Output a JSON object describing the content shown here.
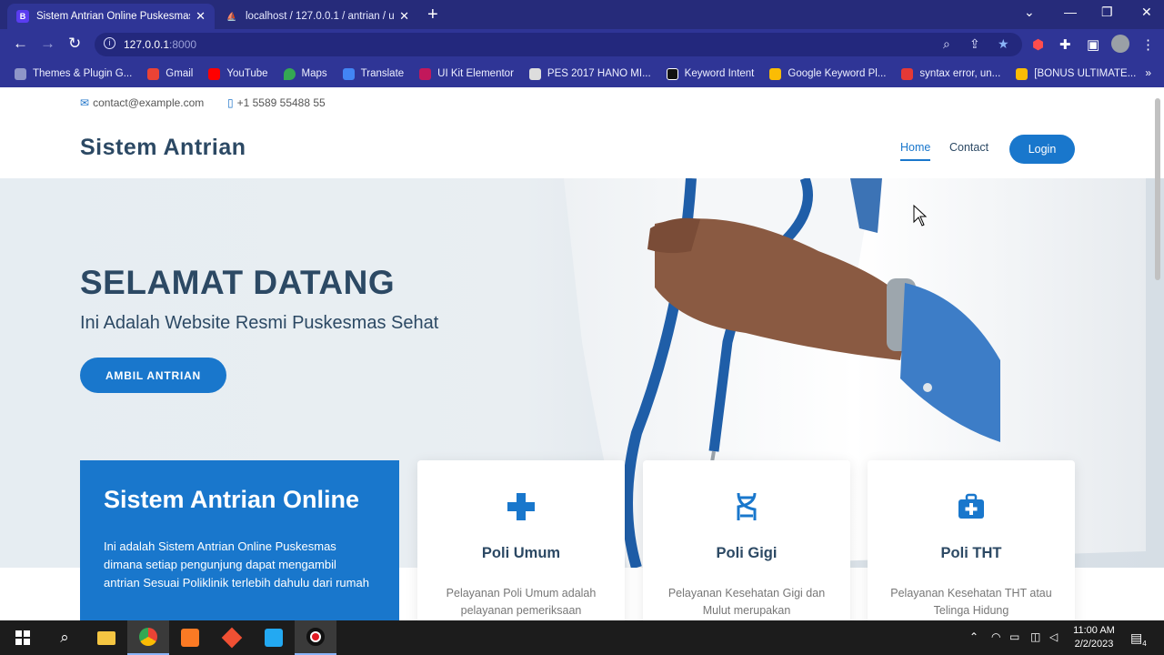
{
  "browser": {
    "tabs": [
      {
        "title": "Sistem Antrian Online Puskesmas",
        "favicon": "B",
        "active": true
      },
      {
        "title": "localhost / 127.0.0.1 / antrian / u",
        "favicon": "phpmyadmin-icon",
        "active": false
      }
    ],
    "url": {
      "host": "127.0.0.1",
      "port": ":8000"
    },
    "bookmarks": [
      {
        "label": "Themes & Plugin G...",
        "color": "#8f96c8"
      },
      {
        "label": "Gmail",
        "color": "#ea4335"
      },
      {
        "label": "YouTube",
        "color": "#ff0000"
      },
      {
        "label": "Maps",
        "color": "#34a853"
      },
      {
        "label": "Translate",
        "color": "#4285f4"
      },
      {
        "label": "UI Kit Elementor",
        "color": "#c2185b"
      },
      {
        "label": "PES 2017 HANO MI...",
        "color": "#dddddd"
      },
      {
        "label": "Keyword Intent",
        "color": "#111111"
      },
      {
        "label": "Google Keyword Pl...",
        "color": "#fbbc04"
      },
      {
        "label": "syntax error, un...",
        "color": "#e53935"
      },
      {
        "label": "[BONUS ULTIMATE...",
        "color": "#fbbc04"
      }
    ]
  },
  "site": {
    "topbar": {
      "email": "contact@example.com",
      "phone": "+1 5589 55488 55"
    },
    "logo": "Sistem Antrian",
    "nav": {
      "home": "Home",
      "contact": "Contact",
      "login": "Login"
    },
    "hero": {
      "title": "SELAMAT DATANG",
      "subtitle": "Ini Adalah Website Resmi Puskesmas Sehat",
      "cta": "AMBIL ANTRIAN"
    },
    "why": {
      "title": "Sistem Antrian Online",
      "text": "Ini adalah Sistem Antrian Online Puskesmas dimana setiap pengunjung dapat mengambil antrian Sesuai Poliklinik terlebih dahulu dari rumah"
    },
    "cards": [
      {
        "title": "Poli Umum",
        "text": "Pelayanan Poli Umum adalah pelayanan pemeriksaan",
        "icon": "plus-icon"
      },
      {
        "title": "Poli Gigi",
        "text": "Pelayanan Kesehatan Gigi dan Mulut merupakan",
        "icon": "dna-icon"
      },
      {
        "title": "Poli THT",
        "text": "Pelayanan Kesehatan THT atau Telinga Hidung",
        "icon": "medkit-icon"
      }
    ],
    "accent": "#1977cc",
    "heading_color": "#2c4964"
  },
  "taskbar": {
    "time": "11:00 AM",
    "date": "2/2/2023",
    "notifications": "4"
  }
}
